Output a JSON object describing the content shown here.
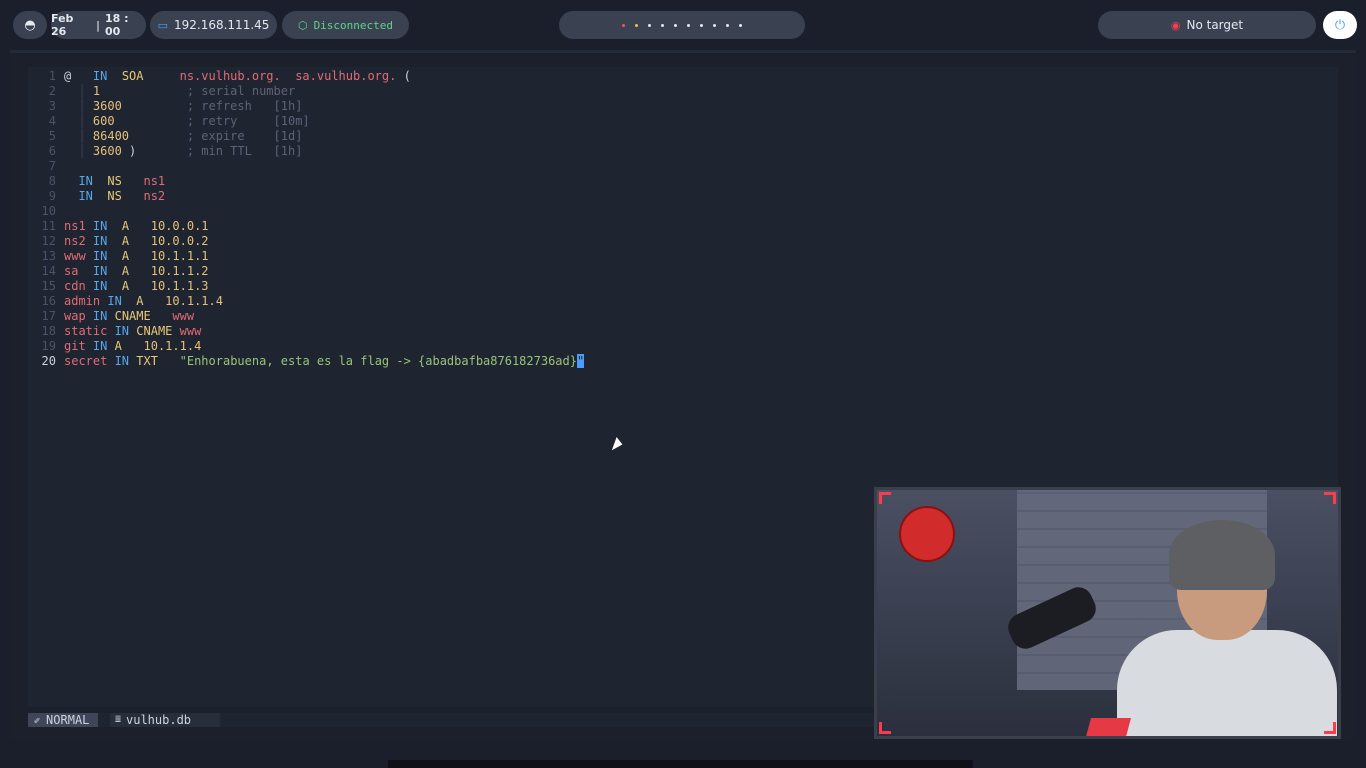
{
  "topbar": {
    "date": "Feb 26",
    "time": "18 : 00",
    "date_sep": "|",
    "ip": "192.168.111.45",
    "vpn_status": "Disconnected",
    "target": "No target",
    "icons": {
      "logo": "arch-logo-icon",
      "ip": "monitor-icon",
      "vpn": "shield-icon",
      "target": "target-icon",
      "power": "power-icon"
    },
    "colors": {
      "vpn": "#5fd38a",
      "target": "#ff3b4e",
      "accent": "#4d9bff"
    }
  },
  "editor": {
    "lines": [
      {
        "n": "1",
        "segments": [
          {
            "t": "@   ",
            "c": "plain"
          },
          {
            "t": "IN  ",
            "c": "kw"
          },
          {
            "t": "SOA     ",
            "c": "rec"
          },
          {
            "t": "ns.vulhub.org.  ",
            "c": "name"
          },
          {
            "t": "sa.vulhub.org. ",
            "c": "name"
          },
          {
            "t": "(",
            "c": "plain"
          }
        ]
      },
      {
        "n": "2",
        "segments": [
          {
            "t": "  │ ",
            "c": "guide"
          },
          {
            "t": "1            ",
            "c": "num"
          },
          {
            "t": "; serial number",
            "c": "cmt"
          }
        ]
      },
      {
        "n": "3",
        "segments": [
          {
            "t": "  │ ",
            "c": "guide"
          },
          {
            "t": "3600         ",
            "c": "num"
          },
          {
            "t": "; refresh   [1h]",
            "c": "cmt"
          }
        ]
      },
      {
        "n": "4",
        "segments": [
          {
            "t": "  │ ",
            "c": "guide"
          },
          {
            "t": "600          ",
            "c": "num"
          },
          {
            "t": "; retry     [10m]",
            "c": "cmt"
          }
        ]
      },
      {
        "n": "5",
        "segments": [
          {
            "t": "  │ ",
            "c": "guide"
          },
          {
            "t": "86400        ",
            "c": "num"
          },
          {
            "t": "; expire    [1d]",
            "c": "cmt"
          }
        ]
      },
      {
        "n": "6",
        "segments": [
          {
            "t": "  │ ",
            "c": "guide"
          },
          {
            "t": "3600 ",
            "c": "num"
          },
          {
            "t": ")       ",
            "c": "plain"
          },
          {
            "t": "; min TTL   [1h]",
            "c": "cmt"
          }
        ]
      },
      {
        "n": "7",
        "segments": []
      },
      {
        "n": "8",
        "segments": [
          {
            "t": "  ",
            "c": "plain"
          },
          {
            "t": "IN  ",
            "c": "kw"
          },
          {
            "t": "NS   ",
            "c": "rec"
          },
          {
            "t": "ns1",
            "c": "name"
          }
        ]
      },
      {
        "n": "9",
        "segments": [
          {
            "t": "  ",
            "c": "plain"
          },
          {
            "t": "IN  ",
            "c": "kw"
          },
          {
            "t": "NS   ",
            "c": "rec"
          },
          {
            "t": "ns2",
            "c": "name"
          }
        ]
      },
      {
        "n": "10",
        "segments": []
      },
      {
        "n": "11",
        "segments": [
          {
            "t": "ns1 ",
            "c": "name"
          },
          {
            "t": "IN  ",
            "c": "kw"
          },
          {
            "t": "A   ",
            "c": "rec"
          },
          {
            "t": "10.0.0.1",
            "c": "num"
          }
        ]
      },
      {
        "n": "12",
        "segments": [
          {
            "t": "ns2 ",
            "c": "name"
          },
          {
            "t": "IN  ",
            "c": "kw"
          },
          {
            "t": "A   ",
            "c": "rec"
          },
          {
            "t": "10.0.0.2",
            "c": "num"
          }
        ]
      },
      {
        "n": "13",
        "segments": [
          {
            "t": "www ",
            "c": "name"
          },
          {
            "t": "IN  ",
            "c": "kw"
          },
          {
            "t": "A   ",
            "c": "rec"
          },
          {
            "t": "10.1.1.1",
            "c": "num"
          }
        ]
      },
      {
        "n": "14",
        "segments": [
          {
            "t": "sa  ",
            "c": "name"
          },
          {
            "t": "IN  ",
            "c": "kw"
          },
          {
            "t": "A   ",
            "c": "rec"
          },
          {
            "t": "10.1.1.2",
            "c": "num"
          }
        ]
      },
      {
        "n": "15",
        "segments": [
          {
            "t": "cdn ",
            "c": "name"
          },
          {
            "t": "IN  ",
            "c": "kw"
          },
          {
            "t": "A   ",
            "c": "rec"
          },
          {
            "t": "10.1.1.3",
            "c": "num"
          }
        ]
      },
      {
        "n": "16",
        "segments": [
          {
            "t": "admin ",
            "c": "name"
          },
          {
            "t": "IN  ",
            "c": "kw"
          },
          {
            "t": "A   ",
            "c": "rec"
          },
          {
            "t": "10.1.1.4",
            "c": "num"
          }
        ]
      },
      {
        "n": "17",
        "segments": [
          {
            "t": "wap ",
            "c": "name"
          },
          {
            "t": "IN ",
            "c": "kw"
          },
          {
            "t": "CNAME   ",
            "c": "rec"
          },
          {
            "t": "www",
            "c": "name"
          }
        ]
      },
      {
        "n": "18",
        "segments": [
          {
            "t": "static ",
            "c": "name"
          },
          {
            "t": "IN ",
            "c": "kw"
          },
          {
            "t": "CNAME ",
            "c": "rec"
          },
          {
            "t": "www",
            "c": "name"
          }
        ]
      },
      {
        "n": "19",
        "segments": [
          {
            "t": "git ",
            "c": "name"
          },
          {
            "t": "IN ",
            "c": "kw"
          },
          {
            "t": "A   ",
            "c": "rec"
          },
          {
            "t": "10.1.1.4",
            "c": "num"
          }
        ]
      },
      {
        "n": "20",
        "current": true,
        "segments": [
          {
            "t": "secret ",
            "c": "name"
          },
          {
            "t": "IN ",
            "c": "kw"
          },
          {
            "t": "TXT   ",
            "c": "rec"
          },
          {
            "t": "\"Enhorabuena, esta es la flag -> {abadbafba876182736ad}",
            "c": "str"
          },
          {
            "t": "\"",
            "c": "cursor"
          }
        ]
      }
    ]
  },
  "statusline": {
    "mode": "NORMAL",
    "mode_icon": "vim-icon",
    "file": "vulhub.db",
    "file_icon": "database-icon"
  }
}
